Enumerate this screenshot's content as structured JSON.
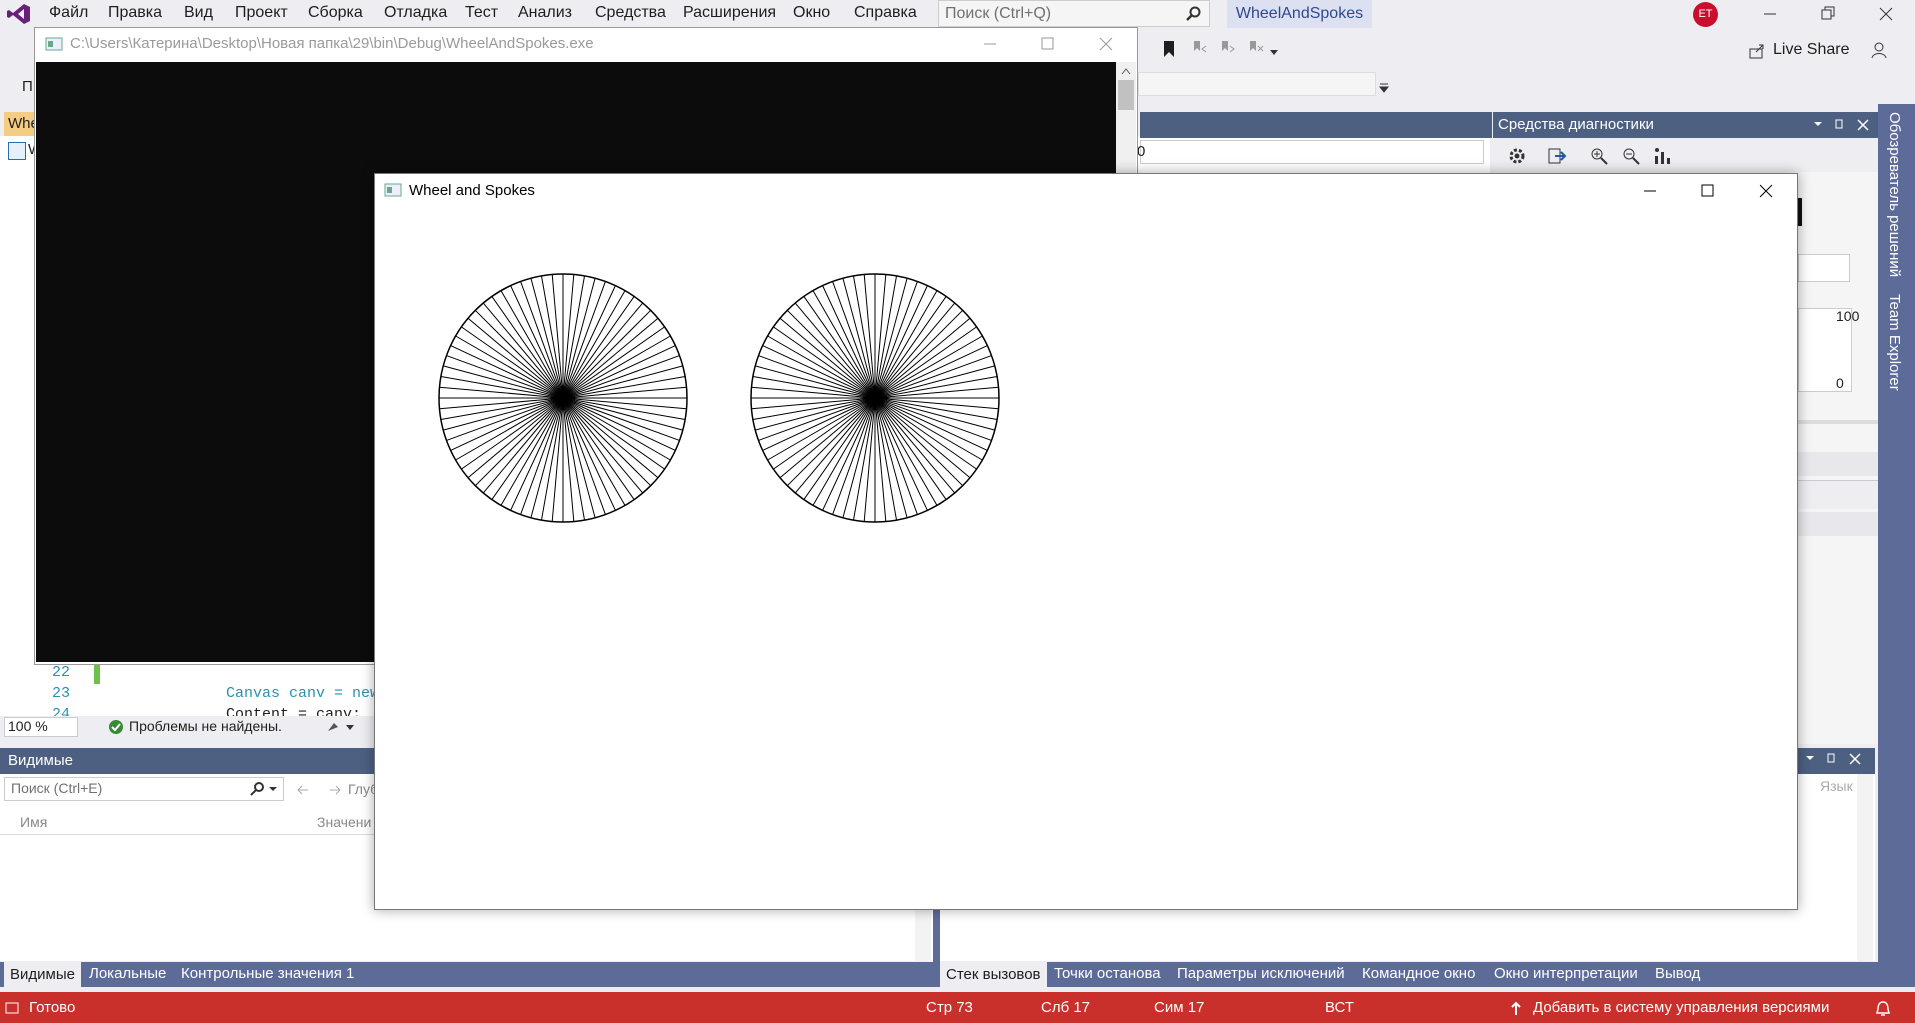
{
  "vs": {
    "menu": [
      "Файл",
      "Правка",
      "Вид",
      "Проект",
      "Сборка",
      "Отладка",
      "Тест",
      "Анализ",
      "Средства",
      "Расширения",
      "Окно",
      "Справка"
    ],
    "search_placeholder": "Поиск (Ctrl+Q)",
    "solution_name": "WheelAndSpokes",
    "user_initials": "ET",
    "live_share": "Live Share",
    "toolbar2_label": "П",
    "editor_tab": "Whe",
    "editor_tab_sub": "W",
    "diag_title": "Средства диагностики",
    "diag_num": "0",
    "diag_axis_top": "100",
    "diag_axis_bottom": "0",
    "right_tabs": [
      "Обозреватель решений",
      "Team Explorer"
    ],
    "code_lines": [
      {
        "num": "22",
        "text": ""
      },
      {
        "num": "23",
        "text": "Canvas canv = new"
      },
      {
        "num": "24",
        "text": "Content = canv;"
      }
    ],
    "zoom": "100 %",
    "issues": "Проблемы не найдены.",
    "locals_title": "Видимые",
    "locals_search": "Поиск (Ctrl+E)",
    "locals_depth": "Глуб",
    "locals_cols": [
      "Имя",
      "Значени"
    ],
    "right_panel_col": "Язык",
    "bottom_tabs_left": [
      "Видимые",
      "Локальные",
      "Контрольные значения 1"
    ],
    "bottom_tabs_right": [
      "Стек вызовов",
      "Точки останова",
      "Параметры исключений",
      "Командное окно",
      "Окно интерпретации",
      "Вывод"
    ],
    "status": {
      "ready": "Готово",
      "line": "Стр 73",
      "col": "Слб 17",
      "ch": "Сим 17",
      "mode": "ВСТ",
      "vcs": "Добавить в систему управления версиями"
    }
  },
  "console": {
    "title": "C:\\Users\\Катерина\\Desktop\\Новая папка\\29\\bin\\Debug\\WheelAndSpokes.exe"
  },
  "wpf": {
    "title": "Wheel and Spokes",
    "wheels": [
      {
        "spokes": 72
      },
      {
        "spokes": 72
      }
    ]
  }
}
